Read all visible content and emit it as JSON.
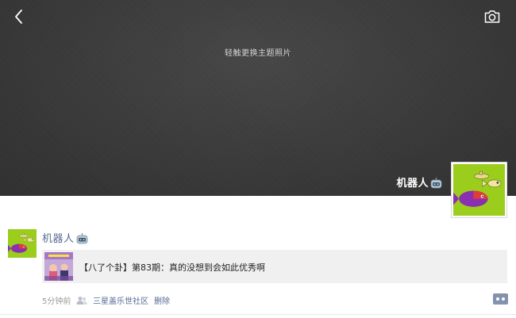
{
  "header": {
    "back_icon": "chevron-left-icon",
    "camera_icon": "camera-icon"
  },
  "cover": {
    "hint": "轻触更换主题照片"
  },
  "profile": {
    "name": "机器人",
    "name_emoji": "robot-icon"
  },
  "moment": {
    "author": "机器人",
    "author_emoji": "robot-icon",
    "link": {
      "title": "【八了个卦】第83期：真的没想到会如此优秀啊"
    },
    "time": "5分钟前",
    "visibility_icon": "people-icon",
    "location": "三星盖乐世社区",
    "delete_label": "删除",
    "comment_icon": "comment-dots-icon"
  },
  "colors": {
    "cover_bg": "#3b3b3b",
    "link_blue": "#576b95",
    "avatar_green": "#9acd1c",
    "card_bg": "#f0f0f0"
  }
}
